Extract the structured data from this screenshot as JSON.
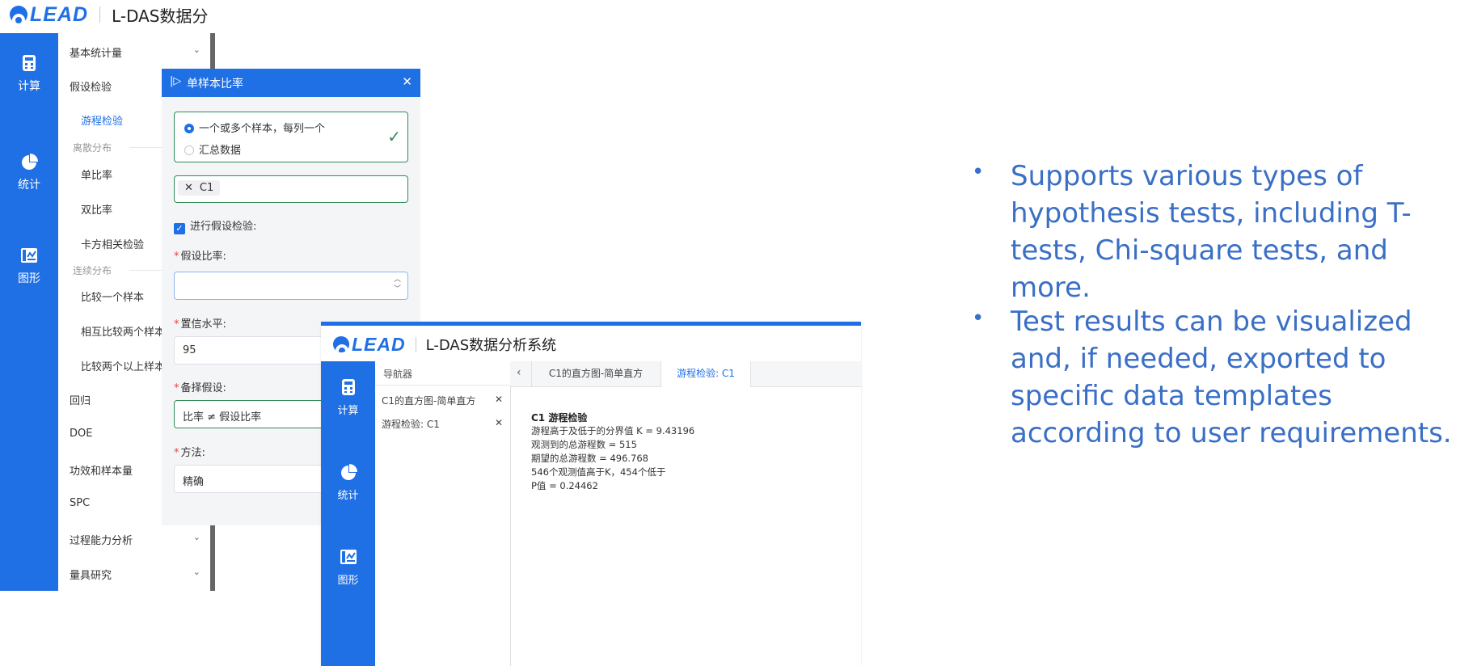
{
  "brand": {
    "logo_text": "LEAD",
    "app_title_truncated": "L-DAS数据分",
    "app_title": "L-DAS数据分析系统"
  },
  "rail": {
    "items": [
      {
        "label": "计算",
        "icon": "calculator-icon"
      },
      {
        "label": "统计",
        "icon": "pie-chart-icon"
      },
      {
        "label": "图形",
        "icon": "chart-board-icon"
      }
    ]
  },
  "menu": {
    "basic_stats": "基本统计量",
    "hypothesis": "假设检验",
    "runs_test": "游程检验",
    "group_discrete": "离散分布",
    "single_ratio": "单比率",
    "double_ratio": "双比率",
    "chisq": "卡方相关检验",
    "group_continuous": "连续分布",
    "compare_one": "比较一个样本",
    "compare_two": "相互比较两个样本",
    "compare_more": "比较两个以上样本",
    "regression": "回归",
    "doe": "DOE",
    "power": "功效和样本量",
    "spc": "SPC",
    "capability": "过程能力分析",
    "gauge": "量具研究"
  },
  "dialog": {
    "title": "单样本比率",
    "option_multi": "一个或多个样本，每列一个",
    "option_summary": "汇总数据",
    "tag_c1": "C1",
    "perform_test": "进行假设检验:",
    "hyp_ratio_label": "假设比率:",
    "hyp_ratio_value": "",
    "conf_label": "置信水平:",
    "conf_value": "95",
    "alt_label": "备择假设:",
    "alt_value": "比率 ≠ 假设比率",
    "method_label": "方法:",
    "method_value": "精确"
  },
  "result_window": {
    "navigator_label": "导航器",
    "nav_items": [
      "C1的直方图-简单直方",
      "游程检验: C1"
    ],
    "tabs": [
      "C1的直方图-简单直方",
      "游程检验: C1"
    ],
    "result_title": "C1 游程检验",
    "result_lines": [
      "游程高于及低于的分界值 K = 9.43196",
      "观测到的总游程数 = 515",
      "期望的总游程数 = 496.768",
      "546个观测值高于K，454个低于",
      "P值 = 0.24462"
    ]
  },
  "bullets": [
    "Supports various types of hypothesis tests, including T-tests, Chi-square tests, and more.",
    "Test results can be visualized and, if needed, exported to specific data templates according to user requirements."
  ],
  "colors": {
    "primary": "#1f6fe5",
    "bullet_text": "#3a6fc6",
    "field_border": "#2e8b57",
    "required": "#e0463b"
  }
}
